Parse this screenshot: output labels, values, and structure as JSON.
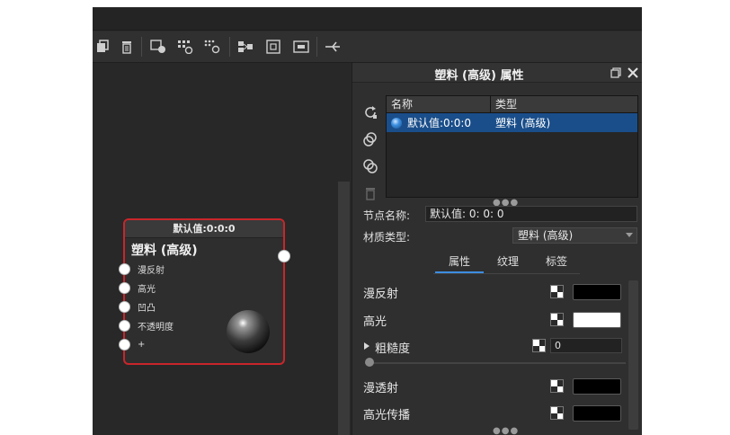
{
  "canvas_node": {
    "header": "默认值:0:0:0",
    "type_label": "塑料 (高级)",
    "inputs": [
      "漫反射",
      "高光",
      "凹凸",
      "不透明度",
      "+"
    ]
  },
  "panel": {
    "title": "塑料 (高级) 属性",
    "table": {
      "col_name": "名称",
      "col_type": "类型",
      "rows": [
        {
          "name": "默认值:0:0:0",
          "type": "塑料 (高级)"
        }
      ]
    },
    "node_name_label": "节点名称:",
    "node_name_value": "默认值: 0: 0: 0",
    "material_type_label": "材质类型:",
    "material_type_value": "塑料 (高级)",
    "tabs": [
      "属性",
      "纹理",
      "标签"
    ],
    "active_tab": 0,
    "properties": {
      "diffuse_label": "漫反射",
      "diffuse_color": "#000000",
      "specular_label": "高光",
      "specular_color": "#ffffff",
      "roughness_label": "粗糙度",
      "roughness_value": "0",
      "translucency_label": "漫透射",
      "translucency_color": "#000000",
      "spec_transmission_label": "高光传播",
      "spec_transmission_color": "#000000"
    }
  },
  "colors": {
    "node_border": "#c8262b",
    "selection": "#1a4e8a",
    "tab_accent": "#3d8de0"
  }
}
